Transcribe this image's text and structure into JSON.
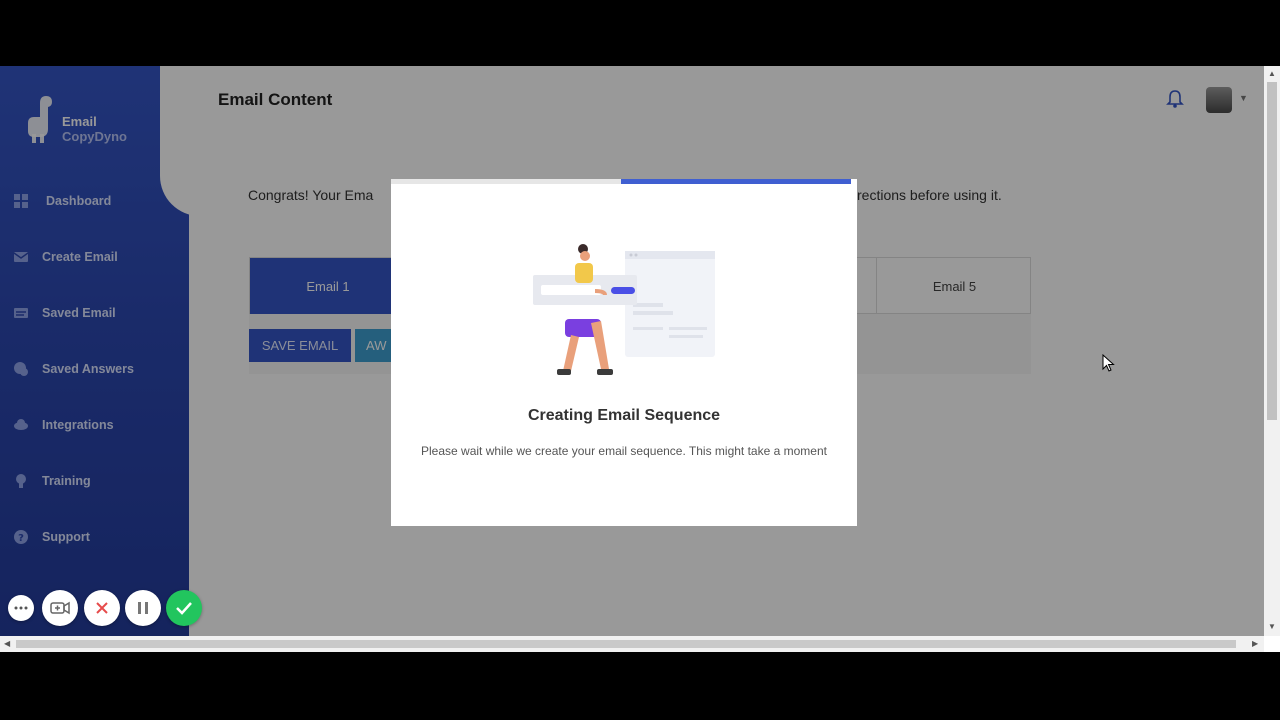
{
  "app": {
    "logo_line1": "Email",
    "logo_line2": "CopyDyno"
  },
  "sidebar": {
    "items": [
      {
        "label": "Dashboard",
        "icon": "dashboard-icon"
      },
      {
        "label": "Create Email",
        "icon": "mail-icon"
      },
      {
        "label": "Saved Email",
        "icon": "saved-mail-icon"
      },
      {
        "label": "Saved Answers",
        "icon": "chat-icon"
      },
      {
        "label": "Integrations",
        "icon": "cloud-icon"
      },
      {
        "label": "Training",
        "icon": "bulb-icon"
      },
      {
        "label": "Support",
        "icon": "help-icon"
      }
    ]
  },
  "header": {
    "title": "Email Content"
  },
  "main": {
    "congrats_left": "Congrats! Your Ema",
    "congrats_right": "rections before using it.",
    "tabs": [
      {
        "label": "Email 1",
        "active": true
      },
      {
        "label": "Email 5",
        "active": false
      }
    ],
    "save_button": "SAVE EMAIL",
    "aw_button": "AW"
  },
  "modal": {
    "progress_fraction": 0.5,
    "title": "Creating Email Sequence",
    "message": "Please wait while we create your email sequence. This might take a moment"
  },
  "colors": {
    "brand": "#3556c6",
    "accent_green": "#22c55e",
    "cancel_red": "#e64b4b"
  }
}
